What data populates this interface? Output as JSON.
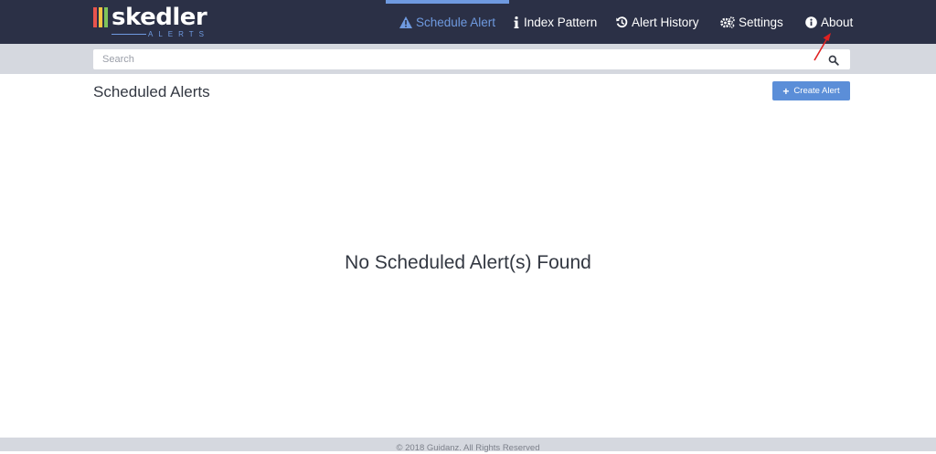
{
  "brand": {
    "name": "skedler",
    "subtitle": "ALERTS",
    "bar_colors": [
      "#e8544e",
      "#f5c342",
      "#7fc45a"
    ]
  },
  "nav": {
    "items": [
      {
        "label": "Schedule Alert",
        "icon": "warning-icon",
        "active": true
      },
      {
        "label": "Index Pattern",
        "icon": "info-icon",
        "active": false
      },
      {
        "label": "Alert History",
        "icon": "history-icon",
        "active": false
      },
      {
        "label": "Settings",
        "icon": "gears-icon",
        "active": false
      },
      {
        "label": "About",
        "icon": "info-circle-icon",
        "active": false
      }
    ]
  },
  "search": {
    "placeholder": "Search",
    "value": ""
  },
  "main": {
    "title": "Scheduled Alerts",
    "create_label": "Create Alert",
    "empty_message": "No Scheduled Alert(s) Found"
  },
  "footer": {
    "text": "© 2018 Guidanz. All Rights Reserved"
  },
  "colors": {
    "navbar": "#2b3046",
    "accent": "#6f9ae0",
    "button": "#5b8ed8",
    "annotation_arrow": "#e02020"
  }
}
